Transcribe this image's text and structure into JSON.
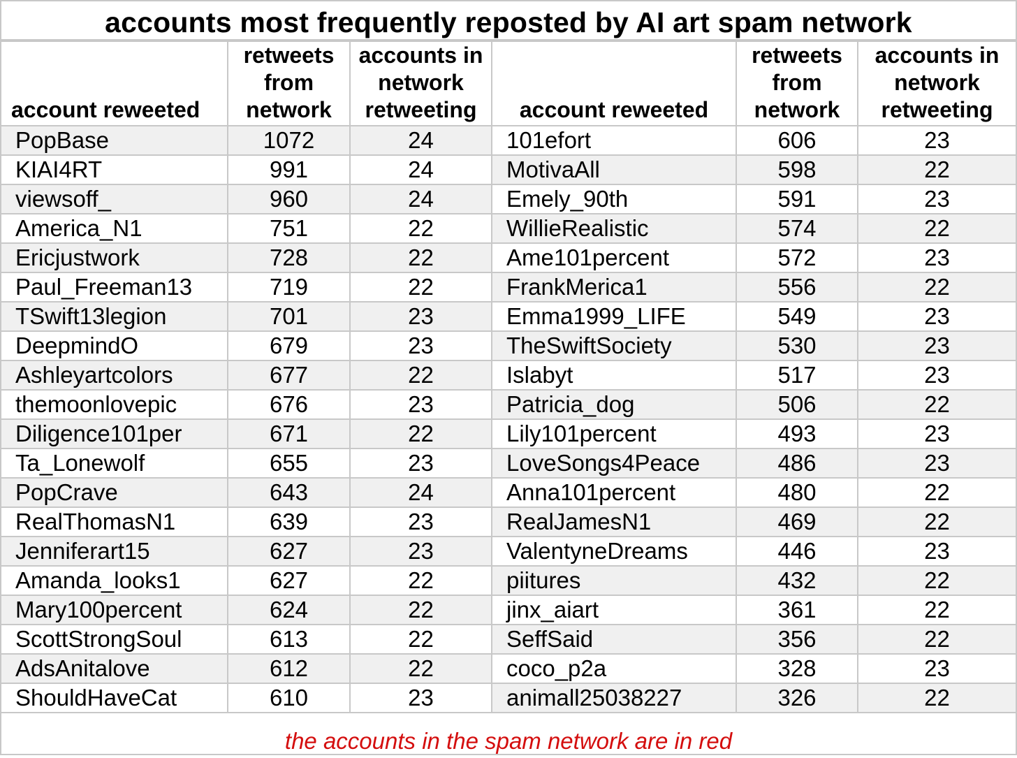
{
  "title": "accounts most frequently reposted by AI art spam network",
  "headers": {
    "account": "account reweeted",
    "retweets": [
      "retweets",
      "from",
      "network"
    ],
    "accounts": [
      "accounts in",
      "network",
      "retweeting"
    ]
  },
  "colors": {
    "spam": "#d40e0e",
    "normal": "#000000",
    "shaded_row": "#f0f0f0",
    "border": "#c8c8c8"
  },
  "left_table": [
    {
      "account": "PopBase",
      "retweets": "1072",
      "accounts": "24",
      "spam": false
    },
    {
      "account": "KIAI4RT",
      "retweets": "991",
      "accounts": "24",
      "spam": false
    },
    {
      "account": "viewsoff_",
      "retweets": "960",
      "accounts": "24",
      "spam": false
    },
    {
      "account": "America_N1",
      "retweets": "751",
      "accounts": "22",
      "spam": true
    },
    {
      "account": "Ericjustwork",
      "retweets": "728",
      "accounts": "22",
      "spam": true
    },
    {
      "account": "Paul_Freeman13",
      "retweets": "719",
      "accounts": "22",
      "spam": true
    },
    {
      "account": "TSwift13legion",
      "retweets": "701",
      "accounts": "23",
      "spam": false
    },
    {
      "account": "DeepmindO",
      "retweets": "679",
      "accounts": "23",
      "spam": true
    },
    {
      "account": "Ashleyartcolors",
      "retweets": "677",
      "accounts": "22",
      "spam": true
    },
    {
      "account": "themoonlovepic",
      "retweets": "676",
      "accounts": "23",
      "spam": false
    },
    {
      "account": "Diligence101per",
      "retweets": "671",
      "accounts": "22",
      "spam": true
    },
    {
      "account": "Ta_Lonewolf",
      "retweets": "655",
      "accounts": "23",
      "spam": true
    },
    {
      "account": "PopCrave",
      "retweets": "643",
      "accounts": "24",
      "spam": false
    },
    {
      "account": "RealThomasN1",
      "retweets": "639",
      "accounts": "23",
      "spam": true
    },
    {
      "account": "Jenniferart15",
      "retweets": "627",
      "accounts": "23",
      "spam": true
    },
    {
      "account": "Amanda_looks1",
      "retweets": "627",
      "accounts": "22",
      "spam": true
    },
    {
      "account": "Mary100percent",
      "retweets": "624",
      "accounts": "22",
      "spam": true
    },
    {
      "account": "ScottStrongSoul",
      "retweets": "613",
      "accounts": "22",
      "spam": true
    },
    {
      "account": "AdsAnitalove",
      "retweets": "612",
      "accounts": "22",
      "spam": true
    },
    {
      "account": "ShouldHaveCat",
      "retweets": "610",
      "accounts": "23",
      "spam": false
    }
  ],
  "right_table": [
    {
      "account": "101efort",
      "retweets": "606",
      "accounts": "23",
      "spam": true
    },
    {
      "account": "MotivaAll",
      "retweets": "598",
      "accounts": "22",
      "spam": false
    },
    {
      "account": "Emely_90th",
      "retweets": "591",
      "accounts": "23",
      "spam": true
    },
    {
      "account": "WillieRealistic",
      "retweets": "574",
      "accounts": "22",
      "spam": true
    },
    {
      "account": "Ame101percent",
      "retweets": "572",
      "accounts": "23",
      "spam": true
    },
    {
      "account": "FrankMerica1",
      "retweets": "556",
      "accounts": "22",
      "spam": true
    },
    {
      "account": "Emma1999_LIFE",
      "retweets": "549",
      "accounts": "23",
      "spam": true
    },
    {
      "account": "TheSwiftSociety",
      "retweets": "530",
      "accounts": "23",
      "spam": false
    },
    {
      "account": "Islabyt",
      "retweets": "517",
      "accounts": "23",
      "spam": true
    },
    {
      "account": "Patricia_dog",
      "retweets": "506",
      "accounts": "22",
      "spam": true
    },
    {
      "account": "Lily101percent",
      "retweets": "493",
      "accounts": "23",
      "spam": true
    },
    {
      "account": "LoveSongs4Peace",
      "retweets": "486",
      "accounts": "23",
      "spam": false
    },
    {
      "account": "Anna101percent",
      "retweets": "480",
      "accounts": "22",
      "spam": true
    },
    {
      "account": "RealJamesN1",
      "retweets": "469",
      "accounts": "22",
      "spam": true
    },
    {
      "account": "ValentyneDreams",
      "retweets": "446",
      "accounts": "23",
      "spam": false
    },
    {
      "account": "piitures",
      "retweets": "432",
      "accounts": "22",
      "spam": false
    },
    {
      "account": "jinx_aiart",
      "retweets": "361",
      "accounts": "22",
      "spam": false
    },
    {
      "account": "SeffSaid",
      "retweets": "356",
      "accounts": "22",
      "spam": false
    },
    {
      "account": "coco_p2a",
      "retweets": "328",
      "accounts": "23",
      "spam": false
    },
    {
      "account": "animall25038227",
      "retweets": "326",
      "accounts": "22",
      "spam": false
    }
  ],
  "footnote": "the accounts in the spam network are in red"
}
